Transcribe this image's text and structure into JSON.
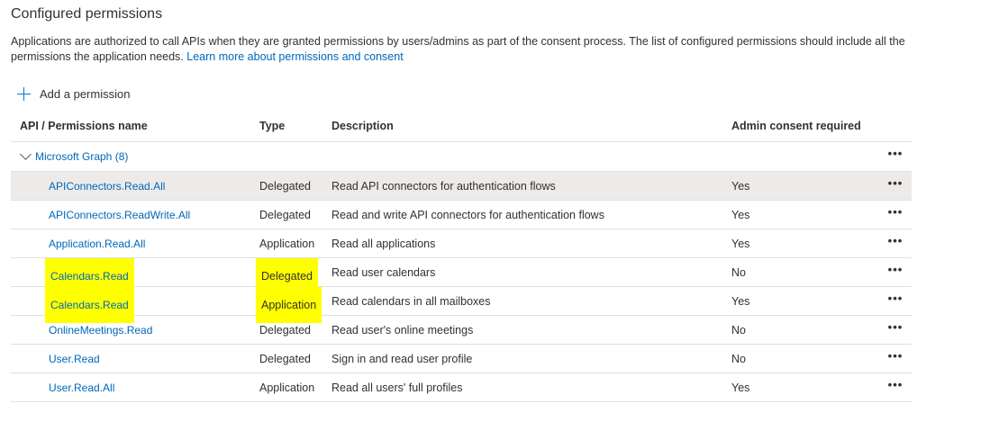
{
  "section_title": "Configured permissions",
  "description": "Applications are authorized to call APIs when they are granted permissions by users/admins as part of the consent process. The list of configured permissions should include all the permissions the application needs.",
  "learn_more_link": "Learn more about permissions and consent",
  "add_permission_label": "Add a permission",
  "columns": {
    "name": "API / Permissions name",
    "type": "Type",
    "description": "Description",
    "admin": "Admin consent required"
  },
  "group": {
    "label": "Microsoft Graph (8)",
    "more": "•••"
  },
  "rows": [
    {
      "name": "APIConnectors.Read.All",
      "type": "Delegated",
      "description": "Read API connectors for authentication flows",
      "admin": "Yes",
      "more": "•••"
    },
    {
      "name": "APIConnectors.ReadWrite.All",
      "type": "Delegated",
      "description": "Read and write API connectors for authentication flows",
      "admin": "Yes",
      "more": "•••"
    },
    {
      "name": "Application.Read.All",
      "type": "Application",
      "description": "Read all applications",
      "admin": "Yes",
      "more": "•••"
    },
    {
      "name": "Calendars.Read",
      "type": "Delegated",
      "description": "Read user calendars",
      "admin": "No",
      "more": "•••"
    },
    {
      "name": "Calendars.Read",
      "type": "Application",
      "description": "Read calendars in all mailboxes",
      "admin": "Yes",
      "more": "•••"
    },
    {
      "name": "OnlineMeetings.Read",
      "type": "Delegated",
      "description": "Read user's online meetings",
      "admin": "No",
      "more": "•••"
    },
    {
      "name": "User.Read",
      "type": "Delegated",
      "description": "Sign in and read user profile",
      "admin": "No",
      "more": "•••"
    },
    {
      "name": "User.Read.All",
      "type": "Application",
      "description": "Read all users' full profiles",
      "admin": "Yes",
      "more": "•••"
    }
  ],
  "colors": {
    "link": "#0067b8",
    "accent": "#0078d4",
    "highlight": "#ffff00",
    "selected_row": "#edebe9"
  }
}
